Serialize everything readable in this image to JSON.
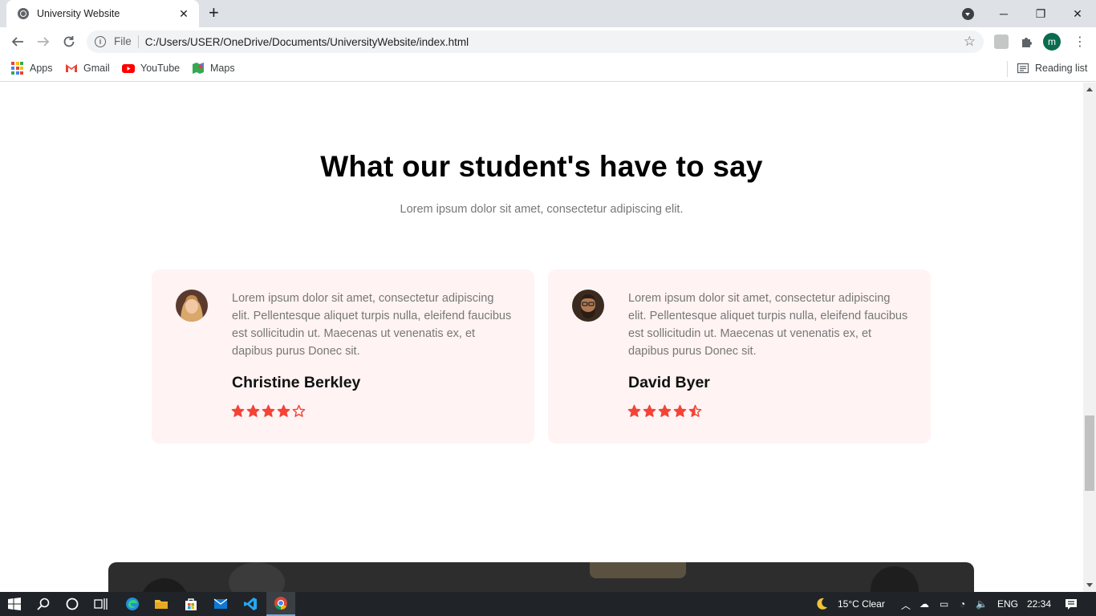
{
  "browser": {
    "tab_title": "University Website",
    "tab_close": "✕",
    "new_tab": "+",
    "window_controls": {
      "minimize": "─",
      "restore": "❐",
      "close": "✕"
    },
    "url_scheme": "File",
    "url": "C:/Users/USER/OneDrive/Documents/UniversityWebsite/index.html",
    "profile_initial": "m",
    "bookmarks": [
      {
        "label": "Apps",
        "icon": "apps-grid-icon"
      },
      {
        "label": "Gmail",
        "icon": "gmail-icon"
      },
      {
        "label": "YouTube",
        "icon": "youtube-icon"
      },
      {
        "label": "Maps",
        "icon": "maps-icon"
      }
    ],
    "reading_list": "Reading list"
  },
  "testimonials": {
    "title": "What our student's have to say",
    "subtitle": "Lorem ipsum dolor sit amet, consectetur adipiscing elit.",
    "items": [
      {
        "text": "Lorem ipsum dolor sit amet, consectetur adipiscing elit. Pellentesque aliquet turpis nulla, eleifend faucibus est sollicitudin ut. Maecenas ut venenatis ex, et dapibus purus Donec sit.",
        "name": "Christine Berkley",
        "rating": 4
      },
      {
        "text": "Lorem ipsum dolor sit amet, consectetur adipiscing elit. Pellentesque aliquet turpis nulla, eleifend faucibus est sollicitudin ut. Maecenas ut venenatis ex, et dapibus purus Donec sit.",
        "name": "David Byer",
        "rating": 4.5
      }
    ]
  },
  "colors": {
    "star": "#f44336",
    "card_bg": "#fff3f3",
    "accent_profile": "#0a6b4f"
  },
  "taskbar": {
    "weather": "15°C  Clear",
    "language": "ENG",
    "time": "22:34"
  }
}
